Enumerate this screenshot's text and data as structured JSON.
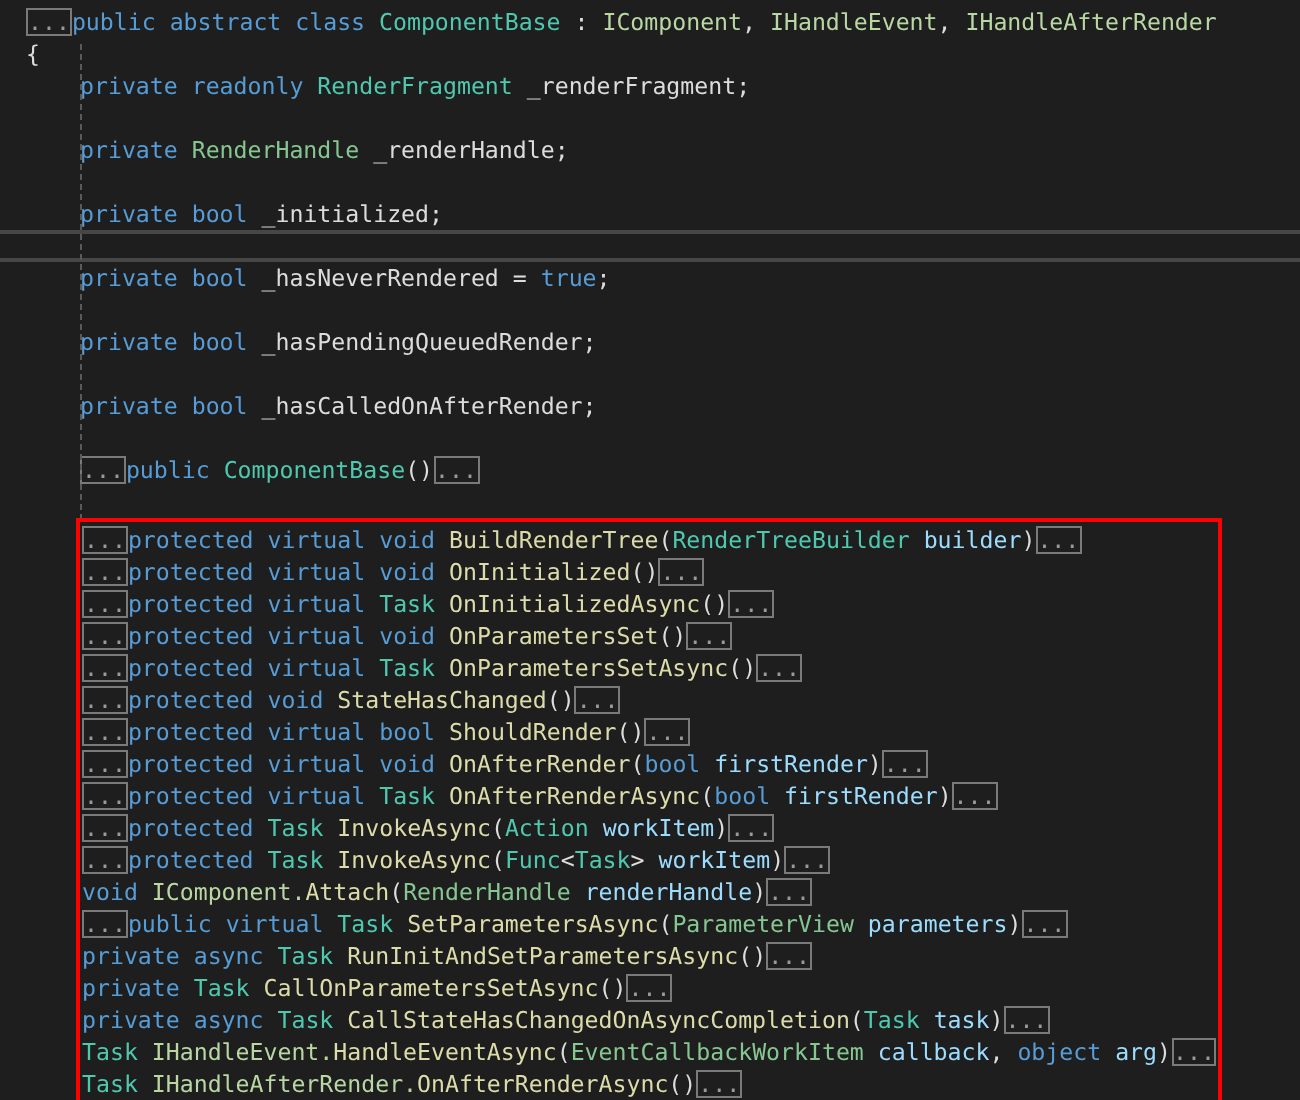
{
  "groups": [
    {
      "boxed": false,
      "lines": [
        {
          "kind": "code",
          "indent": false,
          "tokens": [
            {
              "kind": "fold",
              "text": "..."
            },
            {
              "kind": "keyword",
              "text": "public abstract class "
            },
            {
              "kind": "type",
              "text": "ComponentBase"
            },
            {
              "kind": "plain",
              "text": " : "
            },
            {
              "kind": "interface",
              "text": "IComponent"
            },
            {
              "kind": "plain",
              "text": ", "
            },
            {
              "kind": "interface",
              "text": "IHandleEvent"
            },
            {
              "kind": "plain",
              "text": ", "
            },
            {
              "kind": "interface",
              "text": "IHandleAfterRender"
            }
          ]
        },
        {
          "kind": "code",
          "indent": false,
          "tokens": [
            {
              "kind": "plain",
              "text": "{"
            }
          ]
        },
        {
          "kind": "code",
          "indent": true,
          "tokens": [
            {
              "kind": "keyword",
              "text": "private readonly "
            },
            {
              "kind": "type",
              "text": "RenderFragment"
            },
            {
              "kind": "plain",
              "text": " _renderFragment;"
            }
          ]
        },
        {
          "kind": "blank",
          "current": false
        },
        {
          "kind": "code",
          "indent": true,
          "tokens": [
            {
              "kind": "keyword",
              "text": "private "
            },
            {
              "kind": "struct",
              "text": "RenderHandle"
            },
            {
              "kind": "plain",
              "text": " _renderHandle;"
            }
          ]
        },
        {
          "kind": "blank",
          "current": false
        },
        {
          "kind": "code",
          "indent": true,
          "tokens": [
            {
              "kind": "keyword",
              "text": "private bool "
            },
            {
              "kind": "plain",
              "text": "_initialized;"
            }
          ]
        },
        {
          "kind": "blank",
          "current": true
        },
        {
          "kind": "code",
          "indent": true,
          "tokens": [
            {
              "kind": "keyword",
              "text": "private bool "
            },
            {
              "kind": "plain",
              "text": "_hasNeverRendered = "
            },
            {
              "kind": "keyword",
              "text": "true"
            },
            {
              "kind": "plain",
              "text": ";"
            }
          ]
        },
        {
          "kind": "blank",
          "current": false
        },
        {
          "kind": "code",
          "indent": true,
          "tokens": [
            {
              "kind": "keyword",
              "text": "private bool "
            },
            {
              "kind": "plain",
              "text": "_hasPendingQueuedRender;"
            }
          ]
        },
        {
          "kind": "blank",
          "current": false
        },
        {
          "kind": "code",
          "indent": true,
          "tokens": [
            {
              "kind": "keyword",
              "text": "private bool "
            },
            {
              "kind": "plain",
              "text": "_hasCalledOnAfterRender;"
            }
          ]
        },
        {
          "kind": "blank",
          "current": false
        },
        {
          "kind": "code",
          "indent": true,
          "tokens": [
            {
              "kind": "fold",
              "text": "..."
            },
            {
              "kind": "keyword",
              "text": "public "
            },
            {
              "kind": "type",
              "text": "ComponentBase"
            },
            {
              "kind": "plain",
              "text": "()"
            },
            {
              "kind": "fold",
              "text": "..."
            }
          ]
        },
        {
          "kind": "blank",
          "current": false
        }
      ]
    },
    {
      "boxed": true,
      "lines": [
        {
          "kind": "code",
          "indent": false,
          "tokens": [
            {
              "kind": "fold",
              "text": "..."
            },
            {
              "kind": "keyword",
              "text": "protected virtual void "
            },
            {
              "kind": "method",
              "text": "BuildRenderTree"
            },
            {
              "kind": "plain",
              "text": "("
            },
            {
              "kind": "type",
              "text": "RenderTreeBuilder "
            },
            {
              "kind": "param",
              "text": "builder"
            },
            {
              "kind": "plain",
              "text": ")"
            },
            {
              "kind": "fold",
              "text": "..."
            }
          ]
        },
        {
          "kind": "code",
          "indent": false,
          "tokens": [
            {
              "kind": "fold",
              "text": "..."
            },
            {
              "kind": "keyword",
              "text": "protected virtual void "
            },
            {
              "kind": "method",
              "text": "OnInitialized"
            },
            {
              "kind": "plain",
              "text": "()"
            },
            {
              "kind": "fold",
              "text": "..."
            }
          ]
        },
        {
          "kind": "code",
          "indent": false,
          "tokens": [
            {
              "kind": "fold",
              "text": "..."
            },
            {
              "kind": "keyword",
              "text": "protected virtual "
            },
            {
              "kind": "type",
              "text": "Task "
            },
            {
              "kind": "method",
              "text": "OnInitializedAsync"
            },
            {
              "kind": "plain",
              "text": "()"
            },
            {
              "kind": "fold",
              "text": "..."
            }
          ]
        },
        {
          "kind": "code",
          "indent": false,
          "tokens": [
            {
              "kind": "fold",
              "text": "..."
            },
            {
              "kind": "keyword",
              "text": "protected virtual void "
            },
            {
              "kind": "method",
              "text": "OnParametersSet"
            },
            {
              "kind": "plain",
              "text": "()"
            },
            {
              "kind": "fold",
              "text": "..."
            }
          ]
        },
        {
          "kind": "code",
          "indent": false,
          "tokens": [
            {
              "kind": "fold",
              "text": "..."
            },
            {
              "kind": "keyword",
              "text": "protected virtual "
            },
            {
              "kind": "type",
              "text": "Task "
            },
            {
              "kind": "method",
              "text": "OnParametersSetAsync"
            },
            {
              "kind": "plain",
              "text": "()"
            },
            {
              "kind": "fold",
              "text": "..."
            }
          ]
        },
        {
          "kind": "code",
          "indent": false,
          "tokens": [
            {
              "kind": "fold",
              "text": "..."
            },
            {
              "kind": "keyword",
              "text": "protected void "
            },
            {
              "kind": "method",
              "text": "StateHasChanged"
            },
            {
              "kind": "plain",
              "text": "()"
            },
            {
              "kind": "fold",
              "text": "..."
            }
          ]
        },
        {
          "kind": "code",
          "indent": false,
          "tokens": [
            {
              "kind": "fold",
              "text": "..."
            },
            {
              "kind": "keyword",
              "text": "protected virtual bool "
            },
            {
              "kind": "method",
              "text": "ShouldRender"
            },
            {
              "kind": "plain",
              "text": "()"
            },
            {
              "kind": "fold",
              "text": "..."
            }
          ]
        },
        {
          "kind": "code",
          "indent": false,
          "tokens": [
            {
              "kind": "fold",
              "text": "..."
            },
            {
              "kind": "keyword",
              "text": "protected virtual void "
            },
            {
              "kind": "method",
              "text": "OnAfterRender"
            },
            {
              "kind": "plain",
              "text": "("
            },
            {
              "kind": "keyword",
              "text": "bool "
            },
            {
              "kind": "param",
              "text": "firstRender"
            },
            {
              "kind": "plain",
              "text": ")"
            },
            {
              "kind": "fold",
              "text": "..."
            }
          ]
        },
        {
          "kind": "code",
          "indent": false,
          "tokens": [
            {
              "kind": "fold",
              "text": "..."
            },
            {
              "kind": "keyword",
              "text": "protected virtual "
            },
            {
              "kind": "type",
              "text": "Task "
            },
            {
              "kind": "method",
              "text": "OnAfterRenderAsync"
            },
            {
              "kind": "plain",
              "text": "("
            },
            {
              "kind": "keyword",
              "text": "bool "
            },
            {
              "kind": "param",
              "text": "firstRender"
            },
            {
              "kind": "plain",
              "text": ")"
            },
            {
              "kind": "fold",
              "text": "..."
            }
          ]
        },
        {
          "kind": "code",
          "indent": false,
          "tokens": [
            {
              "kind": "fold",
              "text": "..."
            },
            {
              "kind": "keyword",
              "text": "protected "
            },
            {
              "kind": "type",
              "text": "Task "
            },
            {
              "kind": "method",
              "text": "InvokeAsync"
            },
            {
              "kind": "plain",
              "text": "("
            },
            {
              "kind": "type",
              "text": "Action "
            },
            {
              "kind": "param",
              "text": "workItem"
            },
            {
              "kind": "plain",
              "text": ")"
            },
            {
              "kind": "fold",
              "text": "..."
            }
          ]
        },
        {
          "kind": "code",
          "indent": false,
          "tokens": [
            {
              "kind": "fold",
              "text": "..."
            },
            {
              "kind": "keyword",
              "text": "protected "
            },
            {
              "kind": "type",
              "text": "Task "
            },
            {
              "kind": "method",
              "text": "InvokeAsync"
            },
            {
              "kind": "plain",
              "text": "("
            },
            {
              "kind": "type",
              "text": "Func"
            },
            {
              "kind": "plain",
              "text": "<"
            },
            {
              "kind": "type",
              "text": "Task"
            },
            {
              "kind": "plain",
              "text": "> "
            },
            {
              "kind": "param",
              "text": "workItem"
            },
            {
              "kind": "plain",
              "text": ")"
            },
            {
              "kind": "fold",
              "text": "..."
            }
          ]
        },
        {
          "kind": "code",
          "indent": false,
          "tokens": [
            {
              "kind": "keyword",
              "text": "void "
            },
            {
              "kind": "interface",
              "text": "IComponent."
            },
            {
              "kind": "method",
              "text": "Attach"
            },
            {
              "kind": "plain",
              "text": "("
            },
            {
              "kind": "struct",
              "text": "RenderHandle "
            },
            {
              "kind": "param",
              "text": "renderHandle"
            },
            {
              "kind": "plain",
              "text": ")"
            },
            {
              "kind": "fold",
              "text": "..."
            }
          ]
        },
        {
          "kind": "code",
          "indent": false,
          "tokens": [
            {
              "kind": "fold",
              "text": "..."
            },
            {
              "kind": "keyword",
              "text": "public virtual "
            },
            {
              "kind": "type",
              "text": "Task "
            },
            {
              "kind": "method",
              "text": "SetParametersAsync"
            },
            {
              "kind": "plain",
              "text": "("
            },
            {
              "kind": "struct",
              "text": "ParameterView "
            },
            {
              "kind": "param",
              "text": "parameters"
            },
            {
              "kind": "plain",
              "text": ")"
            },
            {
              "kind": "fold",
              "text": "..."
            }
          ]
        },
        {
          "kind": "code",
          "indent": false,
          "tokens": [
            {
              "kind": "keyword",
              "text": "private async "
            },
            {
              "kind": "type",
              "text": "Task "
            },
            {
              "kind": "method",
              "text": "RunInitAndSetParametersAsync"
            },
            {
              "kind": "plain",
              "text": "()"
            },
            {
              "kind": "fold",
              "text": "..."
            }
          ]
        },
        {
          "kind": "code",
          "indent": false,
          "tokens": [
            {
              "kind": "keyword",
              "text": "private "
            },
            {
              "kind": "type",
              "text": "Task "
            },
            {
              "kind": "method",
              "text": "CallOnParametersSetAsync"
            },
            {
              "kind": "plain",
              "text": "()"
            },
            {
              "kind": "fold",
              "text": "..."
            }
          ]
        },
        {
          "kind": "code",
          "indent": false,
          "tokens": [
            {
              "kind": "keyword",
              "text": "private async "
            },
            {
              "kind": "type",
              "text": "Task "
            },
            {
              "kind": "method",
              "text": "CallStateHasChangedOnAsyncCompletion"
            },
            {
              "kind": "plain",
              "text": "("
            },
            {
              "kind": "type",
              "text": "Task "
            },
            {
              "kind": "param",
              "text": "task"
            },
            {
              "kind": "plain",
              "text": ")"
            },
            {
              "kind": "fold",
              "text": "..."
            }
          ]
        },
        {
          "kind": "code",
          "indent": false,
          "tokens": [
            {
              "kind": "type",
              "text": "Task "
            },
            {
              "kind": "interface",
              "text": "IHandleEvent."
            },
            {
              "kind": "method",
              "text": "HandleEventAsync"
            },
            {
              "kind": "plain",
              "text": "("
            },
            {
              "kind": "struct",
              "text": "EventCallbackWorkItem "
            },
            {
              "kind": "param",
              "text": "callback"
            },
            {
              "kind": "plain",
              "text": ", "
            },
            {
              "kind": "keyword",
              "text": "object "
            },
            {
              "kind": "param",
              "text": "arg"
            },
            {
              "kind": "plain",
              "text": ")"
            },
            {
              "kind": "fold",
              "text": "..."
            }
          ]
        },
        {
          "kind": "code",
          "indent": false,
          "tokens": [
            {
              "kind": "type",
              "text": "Task "
            },
            {
              "kind": "interface",
              "text": "IHandleAfterRender."
            },
            {
              "kind": "method",
              "text": "OnAfterRenderAsync"
            },
            {
              "kind": "plain",
              "text": "()"
            },
            {
              "kind": "fold",
              "text": "..."
            }
          ]
        }
      ]
    }
  ]
}
